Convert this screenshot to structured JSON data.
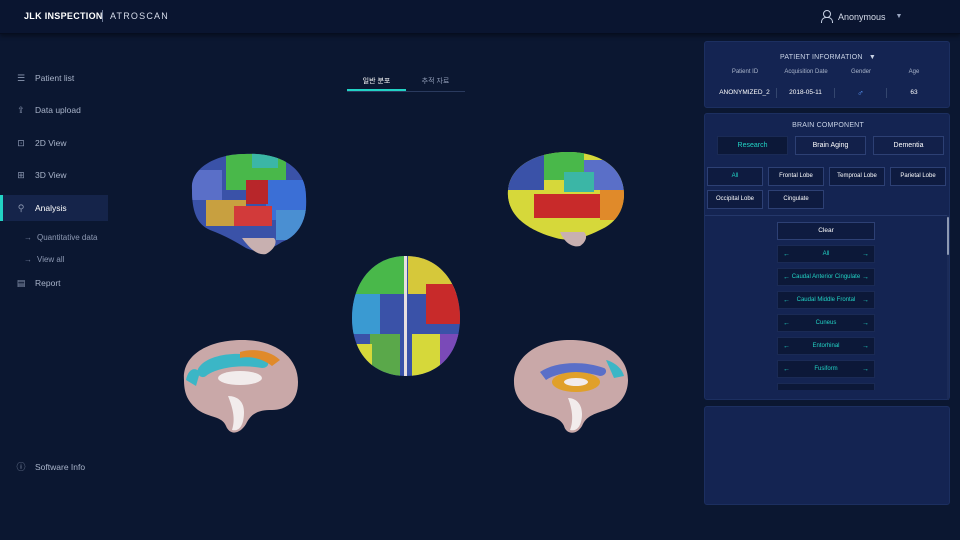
{
  "header": {
    "logo": "JLK INSPECTION",
    "product": "ATROSCAN",
    "user_name": "Anonymous"
  },
  "sidebar": {
    "items": [
      {
        "label": "Patient list",
        "icon": "list-icon"
      },
      {
        "label": "Data upload",
        "icon": "upload-icon"
      },
      {
        "label": "2D View",
        "icon": "view-2d-icon"
      },
      {
        "label": "3D View",
        "icon": "view-3d-icon"
      },
      {
        "label": "Analysis",
        "icon": "analysis-icon",
        "active": true
      },
      {
        "label": "Report",
        "icon": "report-icon"
      }
    ],
    "sub_items": [
      {
        "label": "Quantitative data"
      },
      {
        "label": "View all"
      }
    ],
    "software_info": "Software Info"
  },
  "tabs": [
    {
      "label": "일반 분포",
      "active": true
    },
    {
      "label": "추적 자료",
      "active": false
    }
  ],
  "patient_info": {
    "title": "PATIENT INFORMATION",
    "headers": [
      "Patient ID",
      "Acquisition Date",
      "Gender",
      "Age"
    ],
    "patient_id": "ANONYMIZED_2",
    "acquisition_date": "2018-05-11",
    "gender_symbol": "♂",
    "age": "63"
  },
  "brain_component": {
    "title": "BRAIN COMPONENT",
    "modes": [
      {
        "label": "Research",
        "active": true
      },
      {
        "label": "Brain Aging",
        "active": false
      },
      {
        "label": "Dementia",
        "active": false
      }
    ],
    "lobes": [
      {
        "label": "All",
        "active": true
      },
      {
        "label": "Frontal Lobe",
        "active": false
      },
      {
        "label": "Temproal Lobe",
        "active": false
      },
      {
        "label": "Parietal Lobe",
        "active": false
      },
      {
        "label": "Occipital Lobe",
        "active": false
      },
      {
        "label": "Cingulate",
        "active": false
      }
    ],
    "clear_label": "Clear",
    "regions": [
      "All",
      "Caudal Anterior Cingulate",
      "Caudal Middle Frontal",
      "Cuneus",
      "Entorhinal",
      "Fusiform",
      ""
    ]
  },
  "colors": {
    "accent": "#22d3c5",
    "background": "#0b1731",
    "panel": "#142452"
  }
}
